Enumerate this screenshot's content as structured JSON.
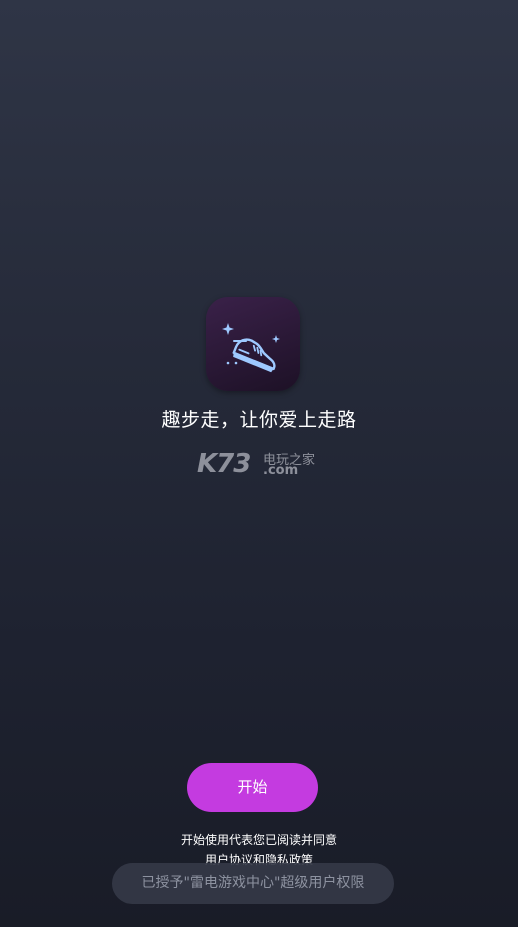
{
  "app": {
    "icon": "sneaker-icon",
    "slogan": "趣步走，让你爱上走路"
  },
  "watermark": {
    "logo": "K73",
    "cn_text": "电玩之家",
    "domain": ".com"
  },
  "actions": {
    "start_label": "开始"
  },
  "consent": {
    "line1": "开始使用代表您已阅读并同意",
    "user_agreement": "用户协议",
    "and": "和",
    "privacy_policy": "隐私政策"
  },
  "toast": {
    "text": "已授予\"雷电游戏中心\"超级用户权限"
  },
  "colors": {
    "accent": "#c43be0",
    "icon_glyph": "#9ec9ff",
    "background_top": "#2f3546",
    "background_bottom": "#191c27"
  }
}
